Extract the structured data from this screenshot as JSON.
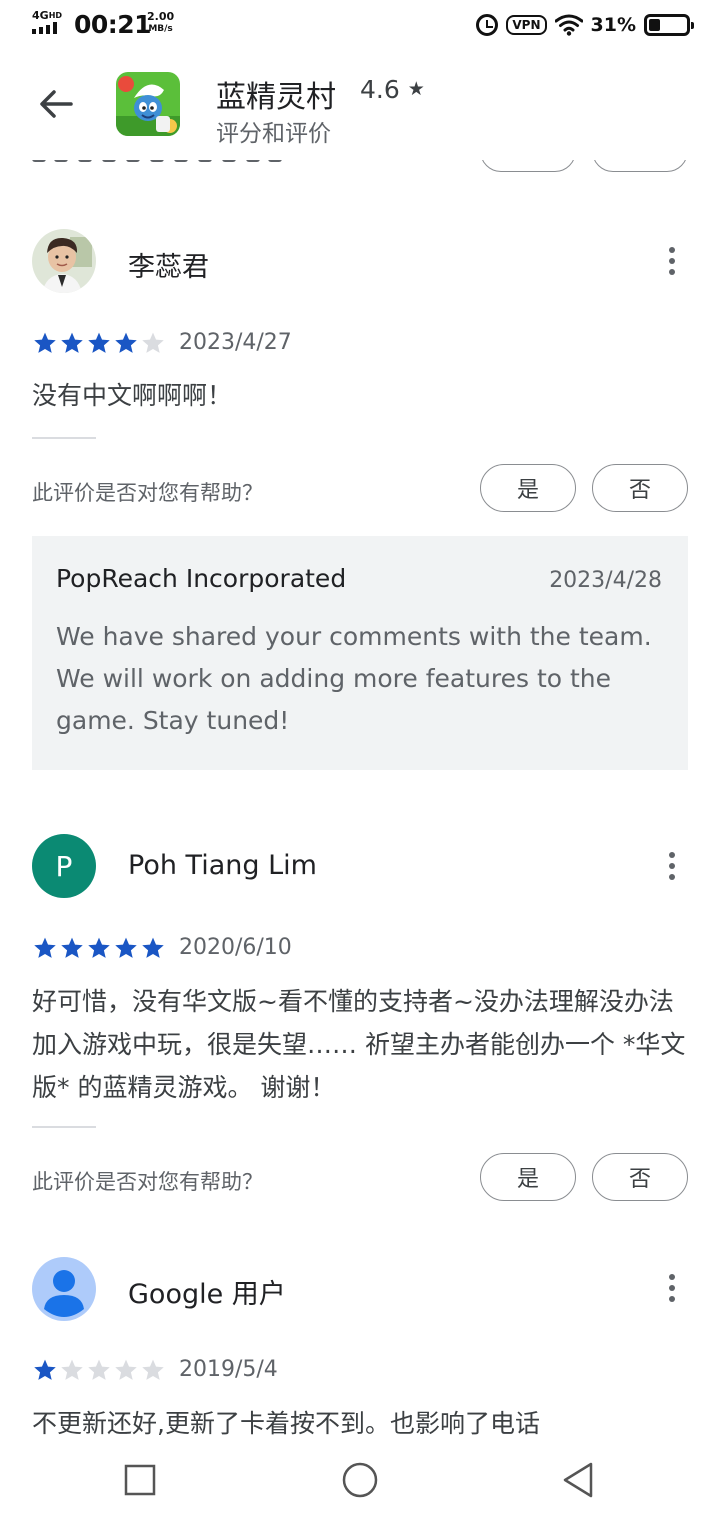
{
  "status_bar": {
    "network": "4G",
    "network_sup": "HD",
    "time": "00:21",
    "speed_value": "2.00",
    "speed_unit": "MB/s",
    "vpn": "VPN",
    "battery_pct": "31%",
    "battery_level": 0.31
  },
  "header": {
    "app_name": "蓝精灵村",
    "rating": "4.6",
    "star": "★",
    "subtitle": "评分和评价"
  },
  "reviews": [
    {
      "name": "李蕊君",
      "rating": 4,
      "date": "2023/4/27",
      "text": "没有中文啊啊啊！",
      "helpful_prompt": "此评价是否对您有帮助？",
      "yes": "是",
      "no": "否",
      "reply": {
        "from": "PopReach Incorporated",
        "date": "2023/4/28",
        "text": "We have shared your comments with the team. We will work on adding more features to the game. Stay tuned!"
      }
    },
    {
      "name": "Poh Tiang Lim",
      "avatar_letter": "P",
      "rating": 5,
      "date": "2020/6/10",
      "text": "好可惜，没有华文版~看不懂的支持者~没办法理解没办法加入游戏中玩，很是失望…… 祈望主办者能创办一个 *华文版* 的蓝精灵游戏。 谢谢！",
      "helpful_prompt": "此评价是否对您有帮助？",
      "yes": "是",
      "no": "否"
    },
    {
      "name": "Google 用户",
      "rating": 1,
      "date": "2019/5/4",
      "text": "不更新还好,更新了卡着按不到。也影响了电话"
    }
  ],
  "colors": {
    "star_filled": "#1a56c4",
    "star_empty": "#dadce0",
    "avatar_p": "#0b8a73",
    "avatar_google": "#aecbfa"
  }
}
